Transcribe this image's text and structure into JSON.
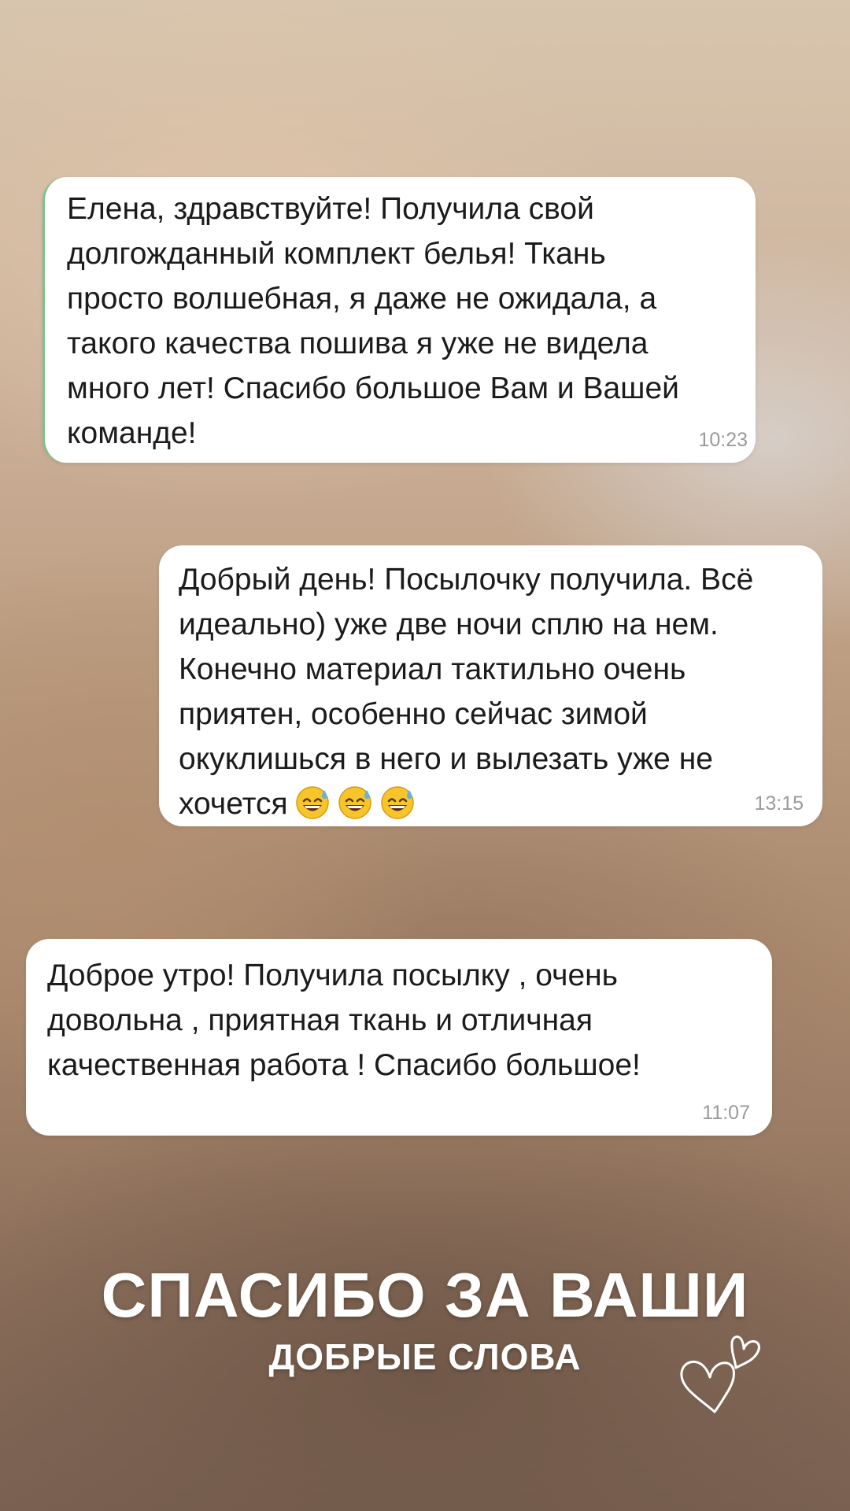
{
  "messages": [
    {
      "text": "Елена, здравствуйте! Получила свой\nдолгожданный комплект белья! Ткань\nпросто волшебная, я даже не ожидала, а\nтакого качества пошива я уже не видела\nмного лет! Спасибо большое Вам и Вашей\nкоманде!",
      "time": "10:23"
    },
    {
      "text": "Добрый день! Посылочку получила. Всё\nидеально) уже две ночи сплю на нем.\nКонечно материал тактильно очень\nприятен, особенно сейчас зимой\nокуклишься в него и вылезать уже не\nхочется",
      "emoji": [
        "grinning-sweat-emoji",
        "grinning-sweat-emoji",
        "grinning-sweat-emoji"
      ],
      "time": "13:15"
    },
    {
      "text": "Доброе утро! Получила посылку , очень\nдовольна   , приятная ткань и отличная\nкачественная работа ! Спасибо большое!",
      "time": "11:07"
    }
  ],
  "caption": {
    "title": "СПАСИБО ЗА ВАШИ",
    "subtitle": "ДОБРЫЕ СЛОВА"
  },
  "decoration": {
    "icon": "hearts-doodle-icon"
  },
  "colors": {
    "bubble": "#ffffff",
    "text": "#1b1b1b",
    "timestamp": "#9a9a9a",
    "caption": "#ffffff"
  }
}
